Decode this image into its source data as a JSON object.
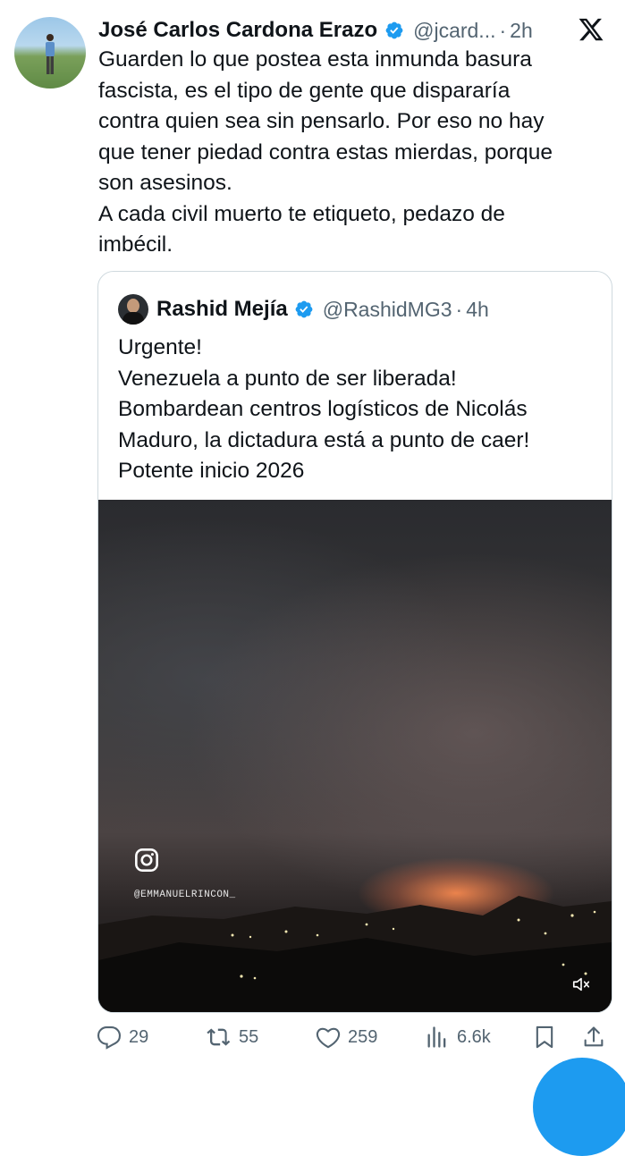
{
  "tweet": {
    "author_name": "José Carlos Cardona Erazo",
    "author_handle": "@jcard...",
    "separator": "·",
    "time": "2h",
    "text": "Guarden lo que postea esta inmunda basura\nfascista, es el tipo de gente que dispararía\ncontra quien sea sin pensarlo. Por eso no hay\nque tener piedad contra estas mierdas, porque\nson asesinos.\nA cada civil muerto te etiqueto, pedazo de\nimbécil."
  },
  "quote": {
    "author_name": "Rashid Mejía",
    "author_handle": "@RashidMG3",
    "separator": "·",
    "time": "4h",
    "text": "Urgente!\nVenezuela a punto de ser liberada!\nBombardean centros logísticos de Nicolás\nMaduro, la dictadura está a punto de caer!\nPotente inicio 2026",
    "media_watermark": "@EMMANUELRINCON_"
  },
  "actions": {
    "replies": "29",
    "reposts": "55",
    "likes": "259",
    "views": "6.6k"
  },
  "icons": [
    "verified-badge-icon",
    "x-logo-icon",
    "instagram-icon",
    "mute-icon",
    "reply-icon",
    "repost-icon",
    "like-icon",
    "views-icon",
    "bookmark-icon",
    "share-icon"
  ],
  "colors": {
    "accent": "#1d9bf0",
    "secondary_text": "#536471",
    "border": "#cfd9de"
  }
}
